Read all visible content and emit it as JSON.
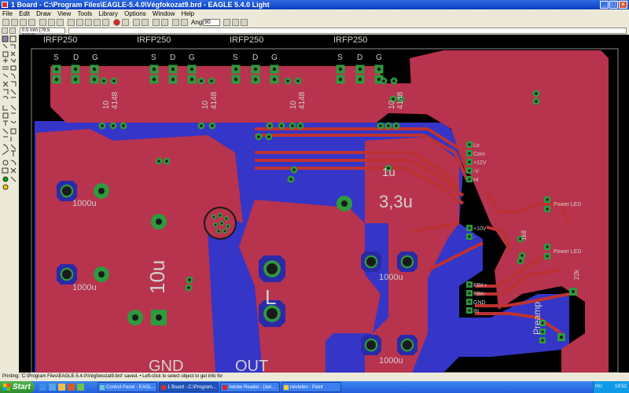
{
  "window": {
    "title": "1 Board - C:\\Program Files\\EAGLE-5.4.0\\Végfokozat9.brd - EAGLE 5.4.0 Light"
  },
  "menu": [
    "File",
    "Edit",
    "Draw",
    "View",
    "Tools",
    "Library",
    "Options",
    "Window",
    "Help"
  ],
  "toolbar": {
    "angle_label": "Angle:",
    "angle_value": "90"
  },
  "command": {
    "coordinate": "0.5 mm (79.5 127.0)"
  },
  "board": {
    "component_names": [
      "IRFP250",
      "IRFP250",
      "IRFP250",
      "IRFP250"
    ],
    "pin_labels": [
      "S",
      "D",
      "G"
    ],
    "diode_labels": [
      "10\n4148",
      "10\n4148",
      "10\n4148",
      "10\n4148"
    ],
    "labels": {
      "c_1u": "1u",
      "c_33u": "3,3u",
      "c_10u": "10u",
      "c_1000u_1": "1000u",
      "c_1000u_2": "1000u",
      "c_1000u_3": "1000u",
      "c_1000u_4": "1000u",
      "inductor": "L",
      "gnd": "GND",
      "out": "OUT",
      "preamp": "Preamp",
      "r_22k": "22k",
      "r_1k8": "1k8",
      "power_led_1": "Power LED",
      "power_led_2": "Power LED"
    },
    "connector_top": [
      "Lo",
      "Com",
      "+12V",
      "-V",
      "Hi"
    ],
    "connector_mid": [
      "+10V",
      "-"
    ],
    "connector_bottom": [
      "FBK+",
      "FBK-",
      "GND",
      "IN"
    ]
  },
  "status": {
    "text": "Printing: 'C:\\Program Files\\EAGLE-5.4.0\\Végfokozat9.brd' saved.   • Left-click to select object to get info for"
  },
  "taskbar": {
    "start": "Start",
    "tasks": [
      "Control Panel - EAGL...",
      "1 Board - C:\\Program...",
      "Adobe Reader - [dat...",
      "névtelen - Paint"
    ],
    "lang": "HU",
    "clock": "18:52"
  },
  "colors": {
    "top_copper": "#b8334e",
    "bottom_copper": "#3535c8",
    "pad": "#2e9a3e",
    "trace": "#bd3232"
  }
}
